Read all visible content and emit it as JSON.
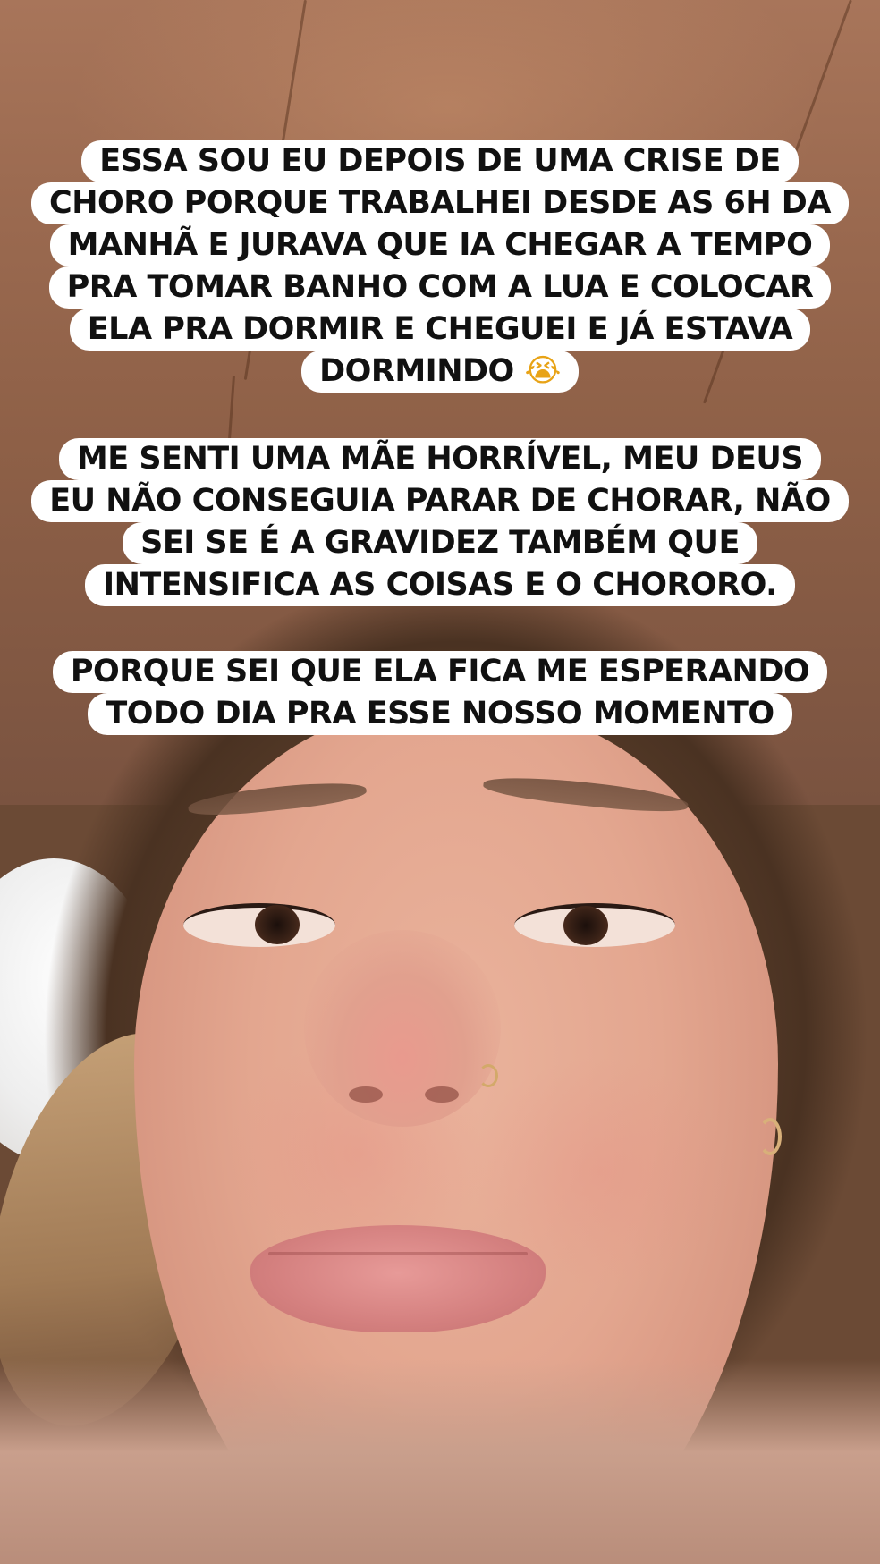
{
  "story": {
    "caption_1": {
      "lines": [
        "ESSA SOU EU DEPOIS DE UMA CRISE DE",
        "CHORO PORQUE TRABALHEI DESDE AS 6H DA",
        "MANHÃ E JURAVA QUE IA CHEGAR A TEMPO",
        "PRA TOMAR BANHO COM A LUA E COLOCAR",
        "ELA PRA DORMIR E CHEGUEI E JÁ ESTAVA",
        "DORMINDO"
      ],
      "emoji": "😭",
      "emoji_icon": "loudly-crying-face-icon"
    },
    "caption_2": {
      "lines": [
        "ME SENTI UMA MÃE HORRÍVEL, MEU DEUS",
        "EU NÃO CONSEGUIA PARAR DE CHORAR, NÃO",
        "SEI SE É A GRAVIDEZ TAMBÉM QUE",
        "INTENSIFICA AS COISAS E O CHORORO."
      ]
    },
    "caption_3": {
      "lines": [
        "PORQUE SEI QUE ELA FICA ME ESPERANDO",
        "TODO DIA PRA ESSE NOSSO MOMENTO"
      ]
    }
  },
  "colors": {
    "caption_background": "#ffffff",
    "caption_text": "#111111"
  }
}
